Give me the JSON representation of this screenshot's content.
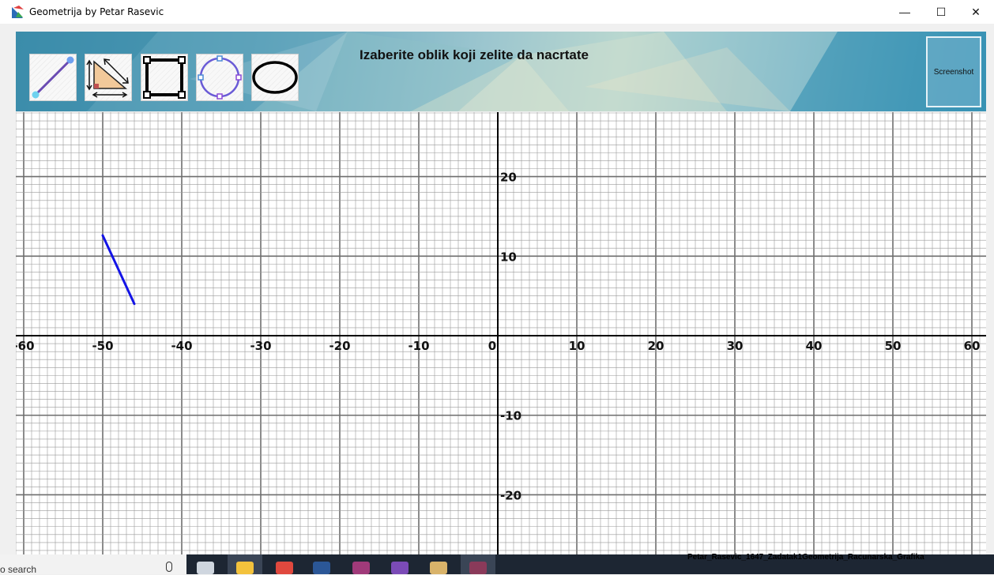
{
  "window": {
    "title": "Geometrija by Petar Rasevic",
    "controls": {
      "minimize": "—",
      "maximize": "☐",
      "close": "✕"
    }
  },
  "header": {
    "prompt": "Izaberite oblik koji zelite da nacrtate",
    "screenshot_label": "Screenshot",
    "tools": [
      {
        "name": "line",
        "icon": "line-tool-icon"
      },
      {
        "name": "triangle",
        "icon": "triangle-tool-icon"
      },
      {
        "name": "rectangle",
        "icon": "rectangle-tool-icon"
      },
      {
        "name": "circle",
        "icon": "circle-tool-icon"
      },
      {
        "name": "ellipse",
        "icon": "ellipse-tool-icon"
      }
    ]
  },
  "chart_data": {
    "type": "line",
    "grid": true,
    "xlim": [
      -61,
      61.8
    ],
    "ylim": [
      -27.5,
      28.1
    ],
    "x_ticks": [
      -60,
      -50,
      -40,
      -30,
      -20,
      -10,
      0,
      10,
      20,
      30,
      40,
      50,
      60
    ],
    "y_ticks": [
      20,
      10,
      -10,
      -20
    ],
    "minor_step": 1,
    "major_step": 10,
    "series": [
      {
        "points": [
          [
            -50,
            12.6
          ],
          [
            -46,
            4
          ]
        ],
        "color": "#1414e6"
      }
    ]
  },
  "taskbar": {
    "search_text": "o search",
    "active_window_label": "Petar_Rasevic_1647_Zadatak1Geometrija_Racunarska_Grafika",
    "apps": [
      {
        "icon": "task-view-icon",
        "color": "#cfd6df"
      },
      {
        "icon": "file-explorer-icon",
        "color": "#f3c23c"
      },
      {
        "icon": "chrome-icon",
        "color": "#e0483e"
      },
      {
        "icon": "word-icon",
        "color": "#2b5797"
      },
      {
        "icon": "winrar-icon",
        "color": "#a03a7a"
      },
      {
        "icon": "visual-studio-icon",
        "color": "#7b4bb7"
      },
      {
        "icon": "paint-icon",
        "color": "#d9b36a"
      },
      {
        "icon": "geometrija-app-icon",
        "color": "#8a3a5a"
      }
    ]
  }
}
